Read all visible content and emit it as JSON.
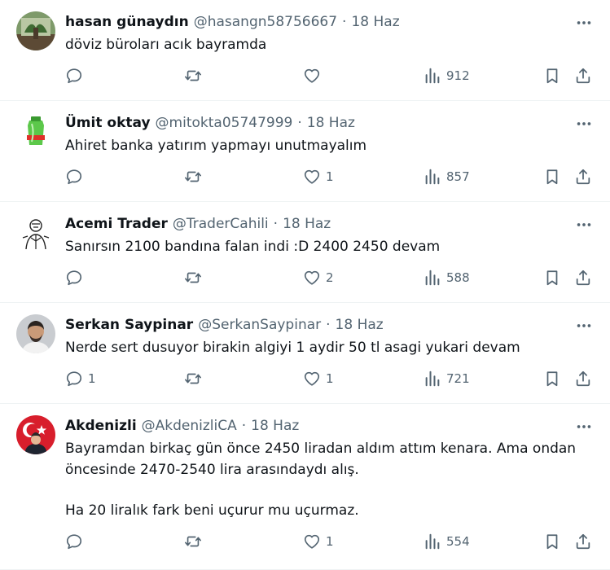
{
  "colors": {
    "text": "#0f1419",
    "muted": "#536471",
    "divider": "#eff3f4"
  },
  "icons": [
    "more-icon",
    "reply-icon",
    "retweet-icon",
    "like-icon",
    "views-icon",
    "bookmark-icon",
    "share-icon"
  ],
  "tweets": [
    {
      "name": "hasan günaydın",
      "handle": "@hasangn58756667",
      "sep": "·",
      "date": "18 Haz",
      "text": [
        "döviz büroları acık bayramda"
      ],
      "replies": "",
      "retweets": "",
      "likes": "",
      "views": "912"
    },
    {
      "name": "Ümit oktay",
      "handle": "@mitokta05747999",
      "sep": "·",
      "date": "18 Haz",
      "text": [
        "Ahiret banka yatırım yapmayı unutmayalım"
      ],
      "replies": "",
      "retweets": "",
      "likes": "1",
      "views": "857"
    },
    {
      "name": "Acemi Trader",
      "handle": "@TraderCahili",
      "sep": "·",
      "date": "18 Haz",
      "text": [
        "Sanırsın 2100 bandına falan indi :D 2400 2450 devam"
      ],
      "replies": "",
      "retweets": "",
      "likes": "2",
      "views": "588"
    },
    {
      "name": "Serkan Saypinar",
      "handle": "@SerkanSaypinar",
      "sep": "·",
      "date": "18 Haz",
      "text": [
        "Nerde sert dusuyor birakin algiyi 1 aydir 50 tl asagi yukari devam"
      ],
      "replies": "1",
      "retweets": "",
      "likes": "1",
      "views": "721"
    },
    {
      "name": "Akdenizli",
      "handle": "@AkdenizliCA",
      "sep": "·",
      "date": "18 Haz",
      "text": [
        "Bayramdan birkaç gün önce 2450 liradan aldım attım kenara. Ama ondan öncesinde 2470-2540 lira arasındaydı alış.",
        "Ha 20 liralık fark beni uçurur mu uçurmaz."
      ],
      "replies": "",
      "retweets": "",
      "likes": "1",
      "views": "554"
    }
  ]
}
